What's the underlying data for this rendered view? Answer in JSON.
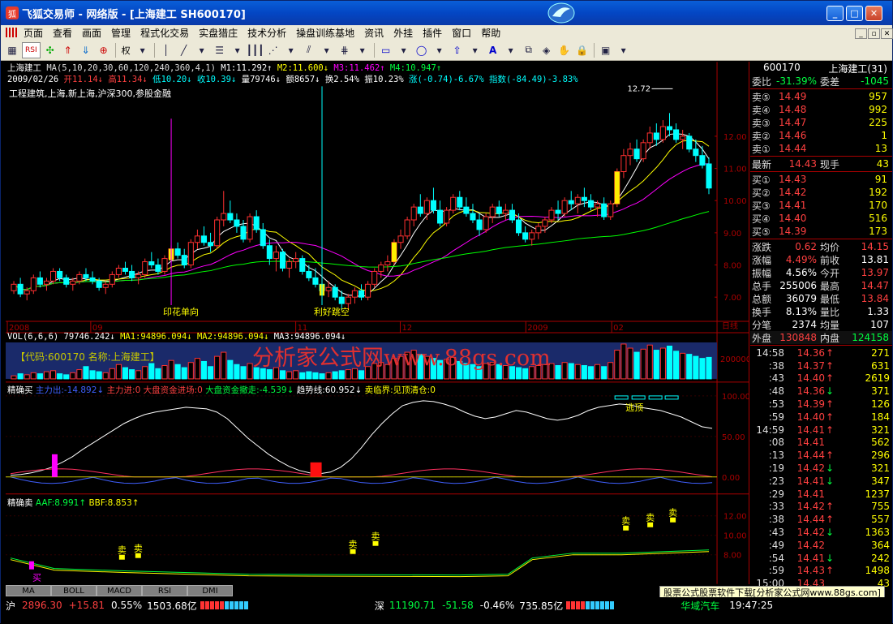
{
  "window": {
    "title": "飞狐交易师 - 网络版 - [上海建工 SH600170]"
  },
  "menu": [
    "页面",
    "查看",
    "画面",
    "管理",
    "程式化交易",
    "实盘猎庄",
    "技术分析",
    "操盘训练基地",
    "资讯",
    "外挂",
    "插件",
    "窗口",
    "帮助"
  ],
  "toolbar": {
    "rsi_label": "RSI",
    "quan_label": "权"
  },
  "chart": {
    "ma_line_name": "上海建工",
    "ma_params": "MA(5,10,20,30,60,120,240,360,4,1)",
    "m1": "M1:11.292↑",
    "m2": "M2:11.600↓",
    "m3": "M3:11.462↑",
    "m4": "M4:10.947↑",
    "date": "2009/02/26",
    "open": "开11.14↓",
    "high": "高11.34↓",
    "low": "低10.20↓",
    "close": "收10.39↓",
    "vol": "量79746↓",
    "amount": "额8657↓",
    "turnover": "换2.54%",
    "swing": "振10.23%",
    "change": "涨(-0.74)-6.67%",
    "index": "指数(-84.49)-3.83%",
    "tags": "工程建筑,上海,新上海,沪深300,参股金融",
    "peak_label": "12.72",
    "annot1": "印花单向",
    "annot2": "利好跳空",
    "price_ticks": [
      "12.00",
      "11.00",
      "10.00",
      "9.00",
      "8.00",
      "7.00"
    ],
    "date_ticks": [
      "2008",
      "09",
      "11",
      "12",
      "2009",
      "02"
    ],
    "day_label": "日线",
    "candles": [
      [
        7.2,
        7.5,
        7.1,
        7.4
      ],
      [
        7.4,
        7.6,
        7.0,
        7.1
      ],
      [
        7.1,
        7.3,
        6.9,
        7.2
      ],
      [
        7.2,
        7.7,
        7.1,
        7.6
      ],
      [
        7.6,
        7.8,
        7.3,
        7.4
      ],
      [
        7.4,
        7.6,
        7.2,
        7.5
      ],
      [
        7.5,
        7.9,
        7.4,
        7.8
      ],
      [
        7.8,
        7.9,
        7.5,
        7.6
      ],
      [
        7.6,
        7.7,
        7.3,
        7.4
      ],
      [
        7.4,
        7.6,
        7.2,
        7.5
      ],
      [
        7.5,
        7.8,
        7.4,
        7.7
      ],
      [
        7.7,
        7.9,
        7.5,
        7.6
      ],
      [
        7.6,
        7.8,
        7.4,
        7.5
      ],
      [
        7.5,
        7.6,
        7.2,
        7.3
      ],
      [
        7.3,
        7.5,
        7.1,
        7.4
      ],
      [
        7.4,
        7.8,
        7.3,
        7.7
      ],
      [
        7.7,
        8.0,
        7.6,
        7.9
      ],
      [
        7.9,
        8.1,
        7.7,
        7.8
      ],
      [
        7.8,
        8.0,
        7.5,
        7.6
      ],
      [
        7.6,
        7.8,
        7.4,
        7.7
      ],
      [
        7.7,
        8.2,
        7.6,
        8.1
      ],
      [
        8.1,
        8.4,
        7.9,
        8.0
      ],
      [
        8.0,
        8.2,
        7.7,
        7.8
      ],
      [
        7.8,
        8.3,
        7.7,
        8.2
      ],
      [
        8.2,
        8.6,
        8.1,
        8.5
      ],
      [
        8.5,
        8.7,
        8.2,
        8.3
      ],
      [
        8.3,
        8.5,
        7.9,
        8.0
      ],
      [
        8.0,
        8.8,
        7.9,
        8.7
      ],
      [
        8.7,
        9.1,
        8.5,
        8.9
      ],
      [
        8.9,
        9.2,
        8.6,
        8.7
      ],
      [
        8.7,
        9.0,
        8.4,
        8.6
      ],
      [
        8.6,
        9.5,
        8.5,
        9.4
      ],
      [
        9.4,
        10.3,
        9.2,
        9.6
      ],
      [
        9.6,
        10.0,
        9.3,
        9.4
      ],
      [
        9.4,
        9.6,
        9.0,
        9.2
      ],
      [
        9.2,
        9.4,
        8.7,
        8.8
      ],
      [
        8.8,
        9.6,
        8.7,
        9.5
      ],
      [
        9.5,
        9.7,
        9.0,
        9.1
      ],
      [
        9.1,
        9.3,
        8.5,
        8.6
      ],
      [
        8.6,
        8.8,
        8.0,
        8.2
      ],
      [
        8.2,
        8.6,
        7.8,
        8.4
      ],
      [
        8.4,
        8.5,
        7.8,
        7.9
      ],
      [
        7.9,
        8.2,
        7.6,
        8.1
      ],
      [
        8.1,
        8.4,
        7.9,
        8.2
      ],
      [
        8.2,
        8.3,
        7.7,
        7.8
      ],
      [
        7.8,
        8.0,
        7.5,
        7.6
      ],
      [
        7.6,
        7.9,
        7.3,
        7.4
      ],
      [
        7.4,
        7.6,
        7.1,
        7.2
      ],
      [
        7.2,
        7.5,
        7.0,
        7.3
      ],
      [
        7.3,
        7.4,
        6.9,
        7.0
      ],
      [
        7.0,
        7.2,
        6.6,
        6.8
      ],
      [
        6.8,
        7.1,
        6.6,
        7.0
      ],
      [
        7.0,
        7.3,
        6.8,
        7.2
      ],
      [
        7.2,
        7.4,
        6.9,
        7.0
      ],
      [
        7.0,
        7.5,
        6.9,
        7.4
      ],
      [
        7.4,
        7.9,
        7.3,
        7.8
      ],
      [
        7.8,
        8.1,
        7.6,
        8.0
      ],
      [
        8.0,
        8.3,
        7.8,
        8.1
      ],
      [
        8.1,
        8.8,
        8.0,
        8.7
      ],
      [
        8.7,
        9.1,
        8.5,
        8.9
      ],
      [
        8.9,
        9.5,
        8.8,
        9.4
      ],
      [
        9.4,
        9.9,
        9.2,
        9.8
      ],
      [
        9.8,
        10.2,
        9.5,
        9.6
      ],
      [
        9.6,
        10.1,
        9.4,
        10.0
      ],
      [
        10.0,
        10.4,
        9.6,
        9.7
      ],
      [
        9.7,
        10.0,
        9.2,
        9.3
      ],
      [
        9.3,
        9.8,
        9.2,
        9.7
      ],
      [
        9.7,
        10.2,
        9.6,
        10.1
      ],
      [
        10.1,
        10.3,
        9.7,
        9.8
      ],
      [
        9.8,
        10.1,
        9.5,
        9.6
      ],
      [
        9.6,
        9.9,
        9.3,
        9.4
      ],
      [
        9.4,
        9.6,
        8.9,
        9.1
      ],
      [
        9.1,
        9.6,
        9.0,
        9.5
      ],
      [
        9.5,
        9.9,
        9.3,
        9.8
      ],
      [
        9.8,
        10.0,
        9.5,
        9.6
      ],
      [
        9.6,
        9.9,
        9.4,
        9.7
      ],
      [
        9.7,
        9.9,
        9.3,
        9.4
      ],
      [
        9.4,
        9.6,
        8.9,
        9.0
      ],
      [
        9.0,
        9.2,
        8.7,
        8.8
      ],
      [
        8.8,
        9.1,
        8.6,
        9.0
      ],
      [
        9.0,
        9.3,
        8.8,
        9.2
      ],
      [
        9.2,
        9.5,
        9.0,
        9.4
      ],
      [
        9.4,
        9.8,
        9.3,
        9.7
      ],
      [
        9.7,
        10.0,
        9.4,
        9.6
      ],
      [
        9.6,
        10.1,
        9.5,
        10.0
      ],
      [
        10.0,
        10.3,
        9.7,
        9.9
      ],
      [
        9.9,
        10.2,
        9.6,
        10.1
      ],
      [
        10.1,
        10.4,
        9.8,
        10.0
      ],
      [
        10.0,
        10.2,
        9.7,
        9.8
      ],
      [
        9.8,
        10.0,
        9.5,
        9.9
      ],
      [
        9.9,
        10.1,
        9.4,
        9.5
      ],
      [
        9.5,
        10.0,
        9.4,
        9.9
      ],
      [
        9.9,
        11.0,
        9.8,
        10.9
      ],
      [
        10.9,
        11.6,
        10.7,
        11.4
      ],
      [
        11.4,
        11.8,
        11.1,
        11.6
      ],
      [
        11.6,
        11.9,
        11.2,
        11.3
      ],
      [
        11.3,
        11.9,
        11.2,
        11.8
      ],
      [
        11.8,
        12.3,
        11.6,
        12.1
      ],
      [
        12.1,
        12.4,
        11.7,
        11.9
      ],
      [
        11.9,
        12.5,
        11.8,
        12.3
      ],
      [
        12.3,
        12.72,
        12.0,
        12.2
      ],
      [
        12.2,
        12.4,
        11.8,
        11.9
      ],
      [
        11.9,
        12.2,
        11.6,
        12.0
      ],
      [
        12.0,
        12.1,
        11.5,
        11.6
      ],
      [
        11.6,
        11.9,
        11.2,
        11.4
      ],
      [
        11.4,
        11.7,
        11.0,
        11.1
      ],
      [
        11.14,
        11.34,
        10.2,
        10.39
      ]
    ]
  },
  "volume": {
    "label": "VOL(6,6,6)",
    "value": "79746.242↓",
    "ma1": "MA1:94896.094↓",
    "ma2": "MA2:94896.094↓",
    "ma3": "MA3:94896.094↓",
    "codename": "【代码:600170 名称:上海建工】",
    "axis_label": "200000"
  },
  "indicator1": {
    "name": "精确买",
    "main_out": "主力出:-14.892↓",
    "main_in": "主力进:0",
    "big_in": "大盘资金进场:0",
    "big_out": "大盘资金撤走:-4.539↓",
    "trend": "趋势线:60.952↓",
    "boundary": "卖临界:见顶清仓:0",
    "top_label": "逃顶",
    "ticks": [
      "100.00",
      "50.00",
      "0.00"
    ]
  },
  "indicator2": {
    "name": "精确卖",
    "aaf": "AAF:8.991↑",
    "bbf": "BBF:8.853↑",
    "sell": "卖",
    "buy": "买",
    "ticks": [
      "12.00",
      "10.00",
      "8.00"
    ]
  },
  "tabs": [
    "MA",
    "BOLL",
    "MACD",
    "RSI",
    "DMI"
  ],
  "watermark": "分析家公式网www.88gs.com",
  "ad": "股票公式股票软件下载[分析家公式网www.88gs.com]",
  "quote": {
    "code": "600170",
    "name": "上海建工(31)",
    "weibi_label": "委比",
    "weibi": "-31.39%",
    "weicha_label": "委差",
    "weicha": "-1045",
    "sells": [
      {
        "label": "卖⑤",
        "price": "14.49",
        "qty": "957"
      },
      {
        "label": "卖④",
        "price": "14.48",
        "qty": "992"
      },
      {
        "label": "卖③",
        "price": "14.47",
        "qty": "225"
      },
      {
        "label": "卖②",
        "price": "14.46",
        "qty": "1"
      },
      {
        "label": "卖①",
        "price": "14.44",
        "qty": "13"
      }
    ],
    "last_label": "最新",
    "last": "14.43",
    "cur_label": "现手",
    "cur": "43",
    "buys": [
      {
        "label": "买①",
        "price": "14.43",
        "qty": "91"
      },
      {
        "label": "买②",
        "price": "14.42",
        "qty": "192"
      },
      {
        "label": "买③",
        "price": "14.41",
        "qty": "170"
      },
      {
        "label": "买④",
        "price": "14.40",
        "qty": "516"
      },
      {
        "label": "买⑤",
        "price": "14.39",
        "qty": "173"
      }
    ],
    "stats": [
      {
        "k": "涨跌",
        "v": "0.62",
        "k2": "均价",
        "v2": "14.15",
        "c": "red",
        "c2": "red"
      },
      {
        "k": "涨幅",
        "v": "4.49%",
        "k2": "前收",
        "v2": "13.81",
        "c": "red",
        "c2": "wht"
      },
      {
        "k": "振幅",
        "v": "4.56%",
        "k2": "今开",
        "v2": "13.97",
        "c": "wht",
        "c2": "red"
      },
      {
        "k": "总手",
        "v": "255006",
        "k2": "最高",
        "v2": "14.47",
        "c": "wht",
        "c2": "red"
      },
      {
        "k": "总额",
        "v": "36079",
        "k2": "最低",
        "v2": "13.84",
        "c": "wht",
        "c2": "red"
      },
      {
        "k": "换手",
        "v": "8.13%",
        "k2": "量比",
        "v2": "1.33",
        "c": "wht",
        "c2": "wht"
      },
      {
        "k": "分笔",
        "v": "2374",
        "k2": "均量",
        "v2": "107",
        "c": "wht",
        "c2": "wht"
      }
    ],
    "outer_label": "外盘",
    "outer": "130848",
    "inner_label": "内盘",
    "inner": "124158",
    "ticks": [
      {
        "t": "14:58",
        "p": "14.36",
        "v": "271",
        "a": "↑",
        "pc": "red",
        "ac": "red"
      },
      {
        "t": ":38",
        "p": "14.37",
        "v": "631",
        "a": "↑",
        "pc": "red",
        "ac": "red"
      },
      {
        "t": ":43",
        "p": "14.40",
        "v": "2619",
        "a": "↑",
        "pc": "red",
        "ac": "red"
      },
      {
        "t": ":48",
        "p": "14.36",
        "v": "371",
        "a": "↓",
        "pc": "red",
        "ac": "grn"
      },
      {
        "t": ":53",
        "p": "14.39",
        "v": "126",
        "a": "↑",
        "pc": "red",
        "ac": "red"
      },
      {
        "t": ":59",
        "p": "14.40",
        "v": "184",
        "a": "↑",
        "pc": "red",
        "ac": "red"
      },
      {
        "t": "14:59",
        "p": "14.41",
        "v": "321",
        "a": "↑",
        "pc": "red",
        "ac": "red"
      },
      {
        "t": ":08",
        "p": "14.41",
        "v": "562",
        "a": "",
        "pc": "red",
        "ac": "red"
      },
      {
        "t": ":13",
        "p": "14.44",
        "v": "296",
        "a": "↑",
        "pc": "red",
        "ac": "red"
      },
      {
        "t": ":19",
        "p": "14.42",
        "v": "321",
        "a": "↓",
        "pc": "red",
        "ac": "grn"
      },
      {
        "t": ":23",
        "p": "14.41",
        "v": "347",
        "a": "↓",
        "pc": "red",
        "ac": "grn"
      },
      {
        "t": ":29",
        "p": "14.41",
        "v": "1237",
        "a": "",
        "pc": "red",
        "ac": "red"
      },
      {
        "t": ":33",
        "p": "14.42",
        "v": "755",
        "a": "↑",
        "pc": "red",
        "ac": "red"
      },
      {
        "t": ":38",
        "p": "14.44",
        "v": "557",
        "a": "↑",
        "pc": "red",
        "ac": "red"
      },
      {
        "t": ":43",
        "p": "14.42",
        "v": "1363",
        "a": "↓",
        "pc": "red",
        "ac": "grn"
      },
      {
        "t": ":49",
        "p": "14.42",
        "v": "364",
        "a": "",
        "pc": "red",
        "ac": "red"
      },
      {
        "t": ":54",
        "p": "14.41",
        "v": "242",
        "a": "↓",
        "pc": "red",
        "ac": "grn"
      },
      {
        "t": ":59",
        "p": "14.43",
        "v": "1498",
        "a": "↑",
        "pc": "red",
        "ac": "red"
      },
      {
        "t": "15:00",
        "p": "14.43",
        "v": "43",
        "a": "",
        "pc": "red",
        "ac": "red"
      }
    ]
  },
  "status": {
    "sh_label": "沪",
    "sh_index": "2896.30",
    "sh_change": "+15.81",
    "sh_pct": "0.55%",
    "sh_amount": "1503.68亿",
    "sz_label": "深",
    "sz_index": "11190.71",
    "sz_change": "-51.58",
    "sz_pct": "-0.46%",
    "sz_amount": "735.85亿",
    "stock": "华域汽车",
    "time": "19:47:25"
  }
}
